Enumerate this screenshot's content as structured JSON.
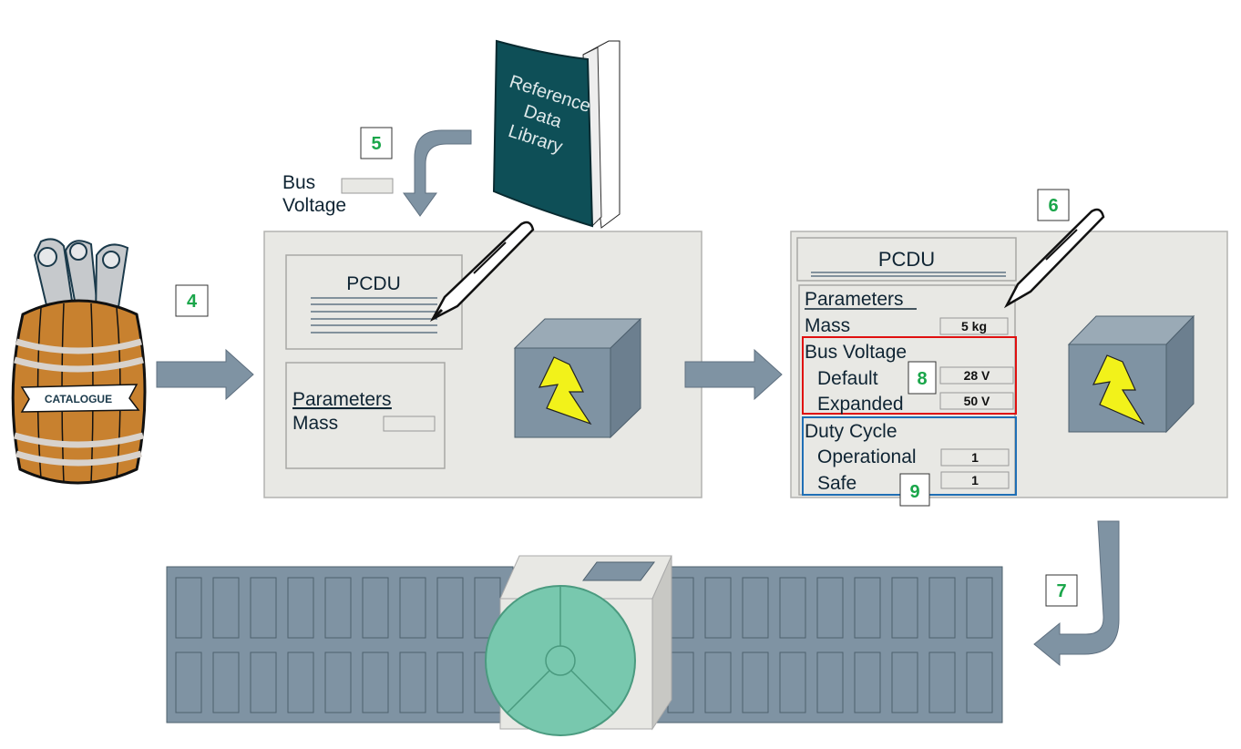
{
  "catalogue": {
    "label": "CATALOGUE"
  },
  "book": {
    "lines": [
      "Reference",
      "Data",
      "Library"
    ]
  },
  "steps": {
    "s4": "4",
    "s5": "5",
    "s6": "6",
    "s7": "7",
    "s8": "8",
    "s9": "9"
  },
  "bus_voltage_label": [
    "Bus",
    "Voltage"
  ],
  "panel1": {
    "title": "PCDU",
    "params_heading": "Parameters",
    "mass_label": "Mass"
  },
  "panel2": {
    "title": "PCDU",
    "params_heading": "Parameters",
    "mass_label": "Mass",
    "mass_value": "5 kg",
    "bus_voltage_heading": "Bus Voltage",
    "default_label": "Default",
    "default_value": "28 V",
    "expanded_label": "Expanded",
    "expanded_value": "50 V",
    "duty_cycle_heading": "Duty Cycle",
    "operational_label": "Operational",
    "operational_value": "1",
    "safe_label": "Safe",
    "safe_value": "1"
  },
  "colors": {
    "arrow": "#7f93a3",
    "panel": "#e8e8e4",
    "step_number": "#1aa64a",
    "bus_voltage_highlight": "#e01010",
    "duty_cycle_highlight": "#1f6fb5",
    "book": "#0e4f57",
    "barrel": "#c8812f",
    "satellite_dish": "#78c8ae"
  }
}
